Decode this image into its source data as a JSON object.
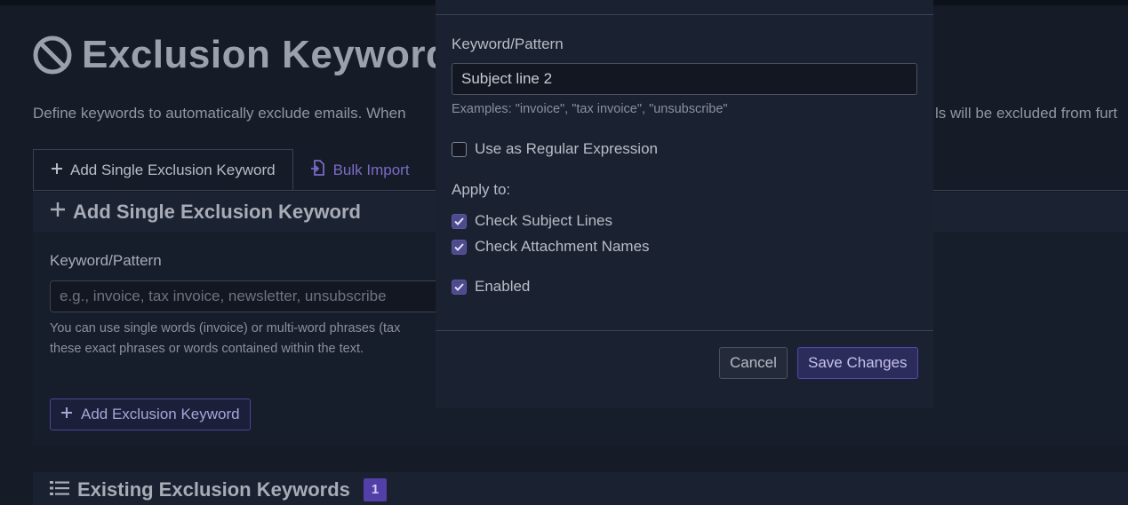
{
  "page": {
    "title": "Exclusion Keywords",
    "description": "Define keywords to automatically exclude emails. When",
    "description_tail": "ls will be excluded from furt"
  },
  "tabs": [
    {
      "label": "Add Single Exclusion Keyword",
      "icon": "plus-icon",
      "active": true
    },
    {
      "label": "Bulk Import",
      "icon": "file-import-icon",
      "active": false
    }
  ],
  "add_card": {
    "header": "Add Single Exclusion Keyword",
    "field_label": "Keyword/Pattern",
    "placeholder": "e.g., invoice, tax invoice, newsletter, unsubscribe",
    "help_line1": "You can use single words (invoice) or multi-word phrases (tax",
    "help_line2": "these exact phrases or words contained within the text.",
    "button_label": "Add Exclusion Keyword"
  },
  "existing": {
    "title": "Existing Exclusion Keywords",
    "count": "1"
  },
  "modal": {
    "field_label": "Keyword/Pattern",
    "value": "Subject line 2",
    "examples": "Examples: \"invoice\", \"tax invoice\", \"unsubscribe\"",
    "regex_label": "Use as Regular Expression",
    "regex_checked": false,
    "apply_label": "Apply to:",
    "subject_label": "Check Subject Lines",
    "subject_checked": true,
    "attachment_label": "Check Attachment Names",
    "attachment_checked": true,
    "enabled_label": "Enabled",
    "enabled_checked": true,
    "cancel_label": "Cancel",
    "save_label": "Save Changes"
  },
  "colors": {
    "background": "#151b27",
    "accent": "#5240a8",
    "checkbox_checked": "#4d4a8e",
    "tab_inactive": "#7a6bc6"
  }
}
